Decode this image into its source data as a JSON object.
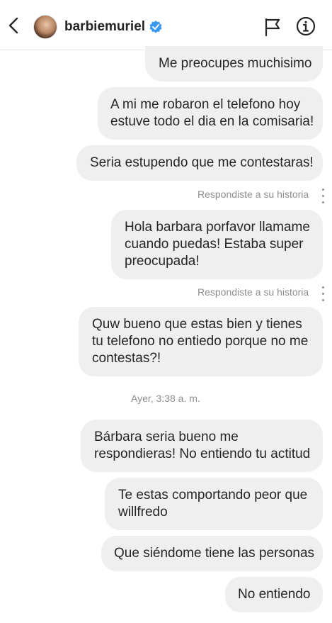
{
  "header": {
    "username": "barbiemuriel",
    "back_icon": "chevron-left-icon",
    "verified_icon": "verified-badge-icon",
    "flag_icon": "flag-icon",
    "info_icon": "info-icon"
  },
  "messages": [
    {
      "text": "Me preocupes muchisimo"
    },
    {
      "text": "A mi me robaron el telefono hoy\nestuve todo el dia en la comisaria!"
    },
    {
      "text": "Seria estupendo que me contestaras!"
    },
    {
      "text": "Hola barbara porfavor llamame\ncuando puedas! Estaba super\npreocupada!"
    },
    {
      "text": "Quw bueno que estas bien y tienes\ntu telefono no entiedo porque no me\ncontestas?!"
    },
    {
      "text": "Bárbara seria bueno me\nrespondieras! No entiendo tu actitud"
    },
    {
      "text": "Te estas comportando peor que\nwillfredo"
    },
    {
      "text": "Que siéndome tiene las personas"
    },
    {
      "text": "No entiendo"
    }
  ],
  "story_replies": [
    {
      "label": "Respondiste a su historia"
    },
    {
      "label": "Respondiste a su historia"
    }
  ],
  "timestamp": "Ayer, 3:38 a. m.",
  "colors": {
    "bubble": "#efefef",
    "meta": "#8e8e8e",
    "verified": "#3897f0"
  }
}
